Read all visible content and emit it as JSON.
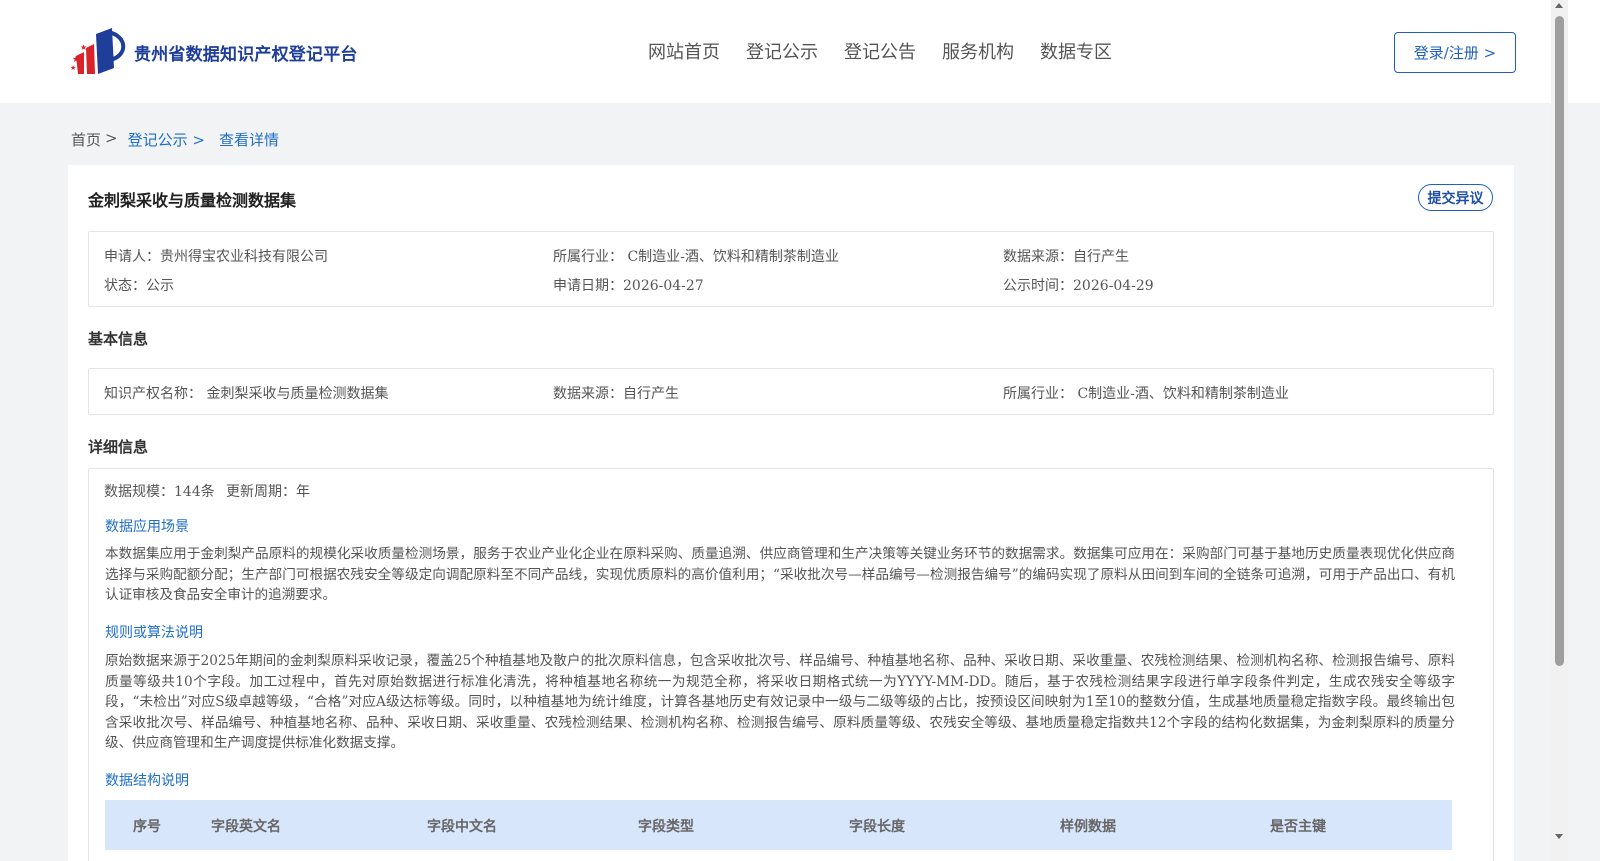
{
  "header": {
    "site_name": "贵州省数据知识产权登记平台",
    "nav": [
      "网站首页",
      "登记公示",
      "登记公告",
      "服务机构",
      "数据专区"
    ],
    "login_label": "登录/注册 >"
  },
  "breadcrumb": {
    "home": "首页",
    "sep": ">",
    "items": [
      "登记公示 >",
      "查看详情"
    ]
  },
  "detail": {
    "title": "金刺梨采收与质量检测数据集",
    "objection_label": "提交异议",
    "summary": {
      "applicant": "申请人：贵州得宝农业科技有限公司",
      "industry": "所属行业： C制造业-酒、饮料和精制茶制造业",
      "source": "数据来源：自行产生",
      "status": "状态：公示",
      "apply_date": "申请日期：2026-04-27",
      "publish_date": "公示时间：2026-04-29"
    },
    "basic": {
      "heading": "基本信息",
      "ip_name": "知识产权名称： 金刺梨采收与质量检测数据集",
      "source": "数据来源：自行产生",
      "industry": "所属行业： C制造业-酒、饮料和精制茶制造业"
    },
    "details": {
      "heading": "详细信息",
      "scale": "数据规模：144条",
      "cycle": "更新周期：年",
      "scenario_title": "数据应用场景",
      "scenario_text": "本数据集应用于金刺梨产品原料的规模化采收质量检测场景，服务于农业产业化企业在原料采购、质量追溯、供应商管理和生产决策等关键业务环节的数据需求。数据集可应用在：采购部门可基于基地历史质量表现优化供应商选择与采购配额分配；生产部门可根据农残安全等级定向调配原料至不同产品线，实现优质原料的高价值利用；“采收批次号—样品编号—检测报告编号”的编码实现了原料从田间到车间的全链条可追溯，可用于产品出口、有机认证审核及食品安全审计的追溯要求。",
      "rules_title": "规则或算法说明",
      "rules_text": "原始数据来源于2025年期间的金刺梨原料采收记录，覆盖25个种植基地及散户的批次原料信息，包含采收批次号、样品编号、种植基地名称、品种、采收日期、采收重量、农残检测结果、检测机构名称、检测报告编号、原料质量等级共10个字段。加工过程中，首先对原始数据进行标准化清洗，将种植基地名称统一为规范全称，将采收日期格式统一为YYYY-MM-DD。随后，基于农残检测结果字段进行单字段条件判定，生成农残安全等级字段，“未检出”对应S级卓越等级，“合格”对应A级达标等级。同时，以种植基地为统计维度，计算各基地历史有效记录中一级与二级等级的占比，按预设区间映射为1至10的整数分值，生成基地质量稳定指数字段。最终输出包含采收批次号、样品编号、种植基地名称、品种、采收日期、采收重量、农残检测结果、检测机构名称、检测报告编号、原料质量等级、农残安全等级、基地质量稳定指数共12个字段的结构化数据集，为金刺梨原料的质量分级、供应商管理和生产调度提供标准化数据支撑。",
      "structure_title": "数据结构说明",
      "table_headers": [
        "序号",
        "字段英文名",
        "字段中文名",
        "字段类型",
        "字段长度",
        "样例数据",
        "是否主键"
      ]
    }
  },
  "colors": {
    "brand_blue": "#1f3e9a",
    "link_blue": "#1f6fc8",
    "table_header_bg": "#d8e6fb"
  }
}
